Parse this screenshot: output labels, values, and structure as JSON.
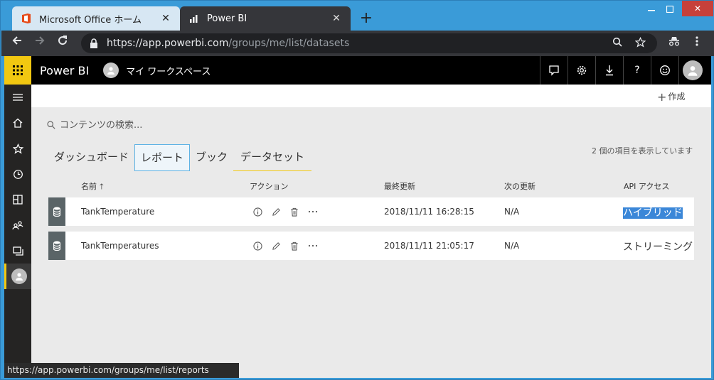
{
  "browser": {
    "tabs": [
      {
        "title": "Microsoft Office ホーム",
        "icon": "office-icon"
      },
      {
        "title": "Power BI",
        "icon": "powerbi-icon"
      }
    ],
    "url_host": "https://app.powerbi.com",
    "url_path": "/groups/me/list/datasets",
    "status_url": "https://app.powerbi.com/groups/me/list/reports"
  },
  "header": {
    "app_name": "Power BI",
    "workspace": "マイ ワークスペース",
    "help_label": "?"
  },
  "action_bar": {
    "create_label": "作成"
  },
  "search": {
    "placeholder": "コンテンツの検索..."
  },
  "content_tabs": [
    "ダッシュボード",
    "レポート",
    "ブック",
    "データセット"
  ],
  "item_count": "2 個の項目を表示しています",
  "columns": {
    "name": "名前",
    "actions": "アクション",
    "last_refresh": "最終更新",
    "next_refresh": "次の更新",
    "api_access": "API アクセス"
  },
  "rows": [
    {
      "name": "TankTemperature",
      "last_refresh": "2018/11/11 16:28:15",
      "next_refresh": "N/A",
      "api_access": "ハイブリッド"
    },
    {
      "name": "TankTemperatures",
      "last_refresh": "2018/11/11 21:05:17",
      "next_refresh": "N/A",
      "api_access": "ストリーミング"
    }
  ],
  "colors": {
    "accent_yellow": "#f2c811",
    "selection_blue": "#3b87d8",
    "chrome_dark": "#35363a"
  }
}
